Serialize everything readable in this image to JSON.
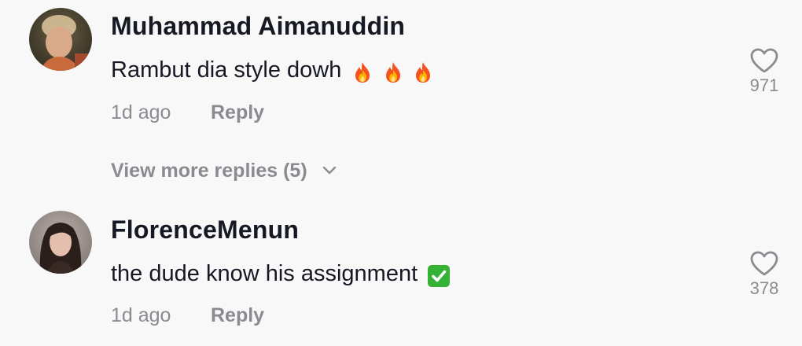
{
  "comments": [
    {
      "username": "Muhammad Aimanuddin",
      "text": "Rambut dia style dowh",
      "emoji": [
        "fire-emoji",
        "fire-emoji",
        "fire-emoji"
      ],
      "time": "1d ago",
      "reply_label": "Reply",
      "likes": "971",
      "view_more": "View more replies (5)"
    },
    {
      "username": "FlorenceMenun",
      "text": "the dude know his assignment",
      "emoji": [
        "check-mark-emoji"
      ],
      "time": "1d ago",
      "reply_label": "Reply",
      "likes": "378"
    }
  ],
  "icons": {
    "like": "heart-outline-icon",
    "expand": "chevron-down-icon"
  },
  "colors": {
    "background": "#f8f8f8",
    "primary_text": "#161823",
    "secondary_text": "#8a8b91",
    "check_green": "#34b233"
  }
}
